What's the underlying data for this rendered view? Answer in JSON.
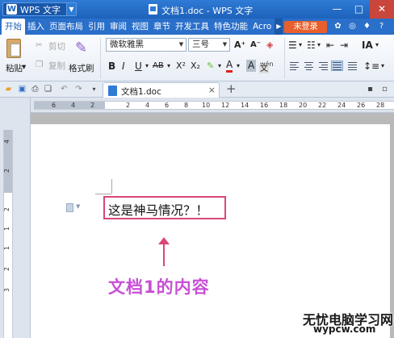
{
  "app": {
    "name": "WPS 文字",
    "logo_glyph": "W",
    "window_title": "文档1.doc - WPS 文字"
  },
  "window_buttons": {
    "minimize": "—",
    "maximize": "□",
    "close": "✕"
  },
  "tabs": [
    "开始",
    "插入",
    "页面布局",
    "引用",
    "审阅",
    "视图",
    "章节",
    "开发工具",
    "特色功能",
    "Acro"
  ],
  "active_tab_index": 0,
  "login_label": "未登录",
  "ribbon": {
    "paste_label": "粘贴",
    "cut_label": "剪切",
    "copy_label": "复制",
    "format_painter_label": "格式刷",
    "font_name": "微软雅黑",
    "font_size": "三号",
    "bold": "B",
    "italic": "I",
    "underline": "U",
    "strikethrough": "AB",
    "superscript": "X²",
    "subscript": "X₂",
    "font_color": "A",
    "char_shading": "A",
    "pinyin": "wén",
    "grow_font": "A⁺",
    "shrink_font": "A⁻",
    "style_label": "Aa"
  },
  "doc_tab": {
    "label": "文档1.doc",
    "close": "×",
    "new_tab": "+"
  },
  "ruler": {
    "h_numbers": [
      "6",
      "4",
      "2",
      "2",
      "4",
      "6",
      "8",
      "10",
      "12",
      "14",
      "16",
      "18",
      "20",
      "22",
      "24",
      "26",
      "28"
    ],
    "v_numbers": [
      "4",
      "2",
      "2",
      "1",
      "1",
      "2",
      "3"
    ]
  },
  "document": {
    "text": "这是神马情况？！",
    "annotation": "文档1的内容"
  },
  "watermark": {
    "line1": "无忧电脑学习网",
    "line2": "wypcw.com"
  },
  "colors": {
    "title_bar": "#2f7bd6",
    "login": "#e95f2b",
    "highlight": "#d9467a",
    "annotation_text": "#c84fd6"
  }
}
